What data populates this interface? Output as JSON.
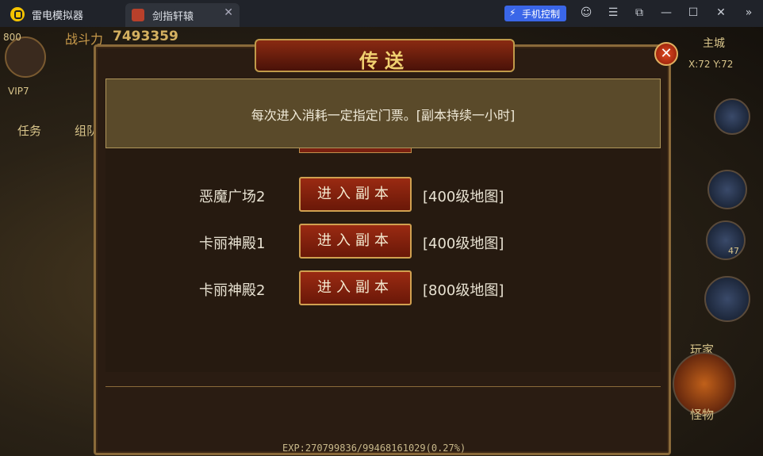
{
  "titlebar": {
    "app_title": "雷电模拟器",
    "tab_label": "剑指轩辕",
    "tab_close": "✕",
    "phone_control": "手机控制",
    "controls": [
      "☺",
      "☰",
      "⧉",
      "—",
      "☐",
      "✕",
      "»"
    ]
  },
  "hud": {
    "level": "800",
    "power_label": "战斗力",
    "power_value": "7493359",
    "vip": "VIP7",
    "task_tab": "任务",
    "team_tab": "组队",
    "map_name": "主城",
    "coords": "X:72 Y:72",
    "player_label": "玩家",
    "monster_label": "怪物",
    "skill_count": "47"
  },
  "dialog": {
    "title": "传送",
    "close_glyph": "✕",
    "notice": "每次进入消耗一定指定门票。[副本持续一小时]",
    "dungeons": [
      {
        "name": "恶魔广场2",
        "button": "进入副本",
        "level": "[400级地图]"
      },
      {
        "name": "卡丽神殿1",
        "button": "进入副本",
        "level": "[400级地图]"
      },
      {
        "name": "卡丽神殿2",
        "button": "进入副本",
        "level": "[800级地图]"
      }
    ]
  },
  "footer": {
    "exp": "EXP:270799836/99468161029(0.27%)"
  },
  "colors": {
    "accent_blue": "#3a66e8",
    "dialog_border": "#8a6a3a",
    "button_red": "#9a2a12",
    "title_gold": "#f0d070"
  }
}
